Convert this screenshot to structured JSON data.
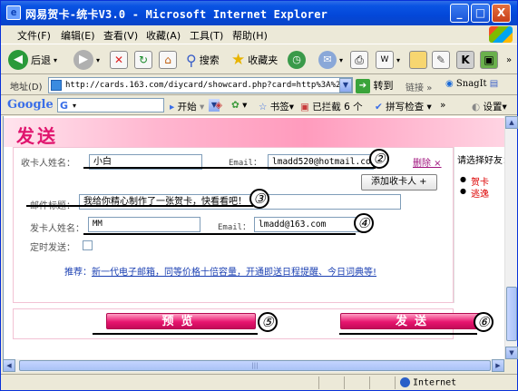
{
  "window": {
    "title": "网易贺卡-统卡V3.0 - Microsoft Internet Explorer",
    "controls": {
      "minimize": "_",
      "maximize": "□",
      "close": "X"
    }
  },
  "menu": [
    "文件(F)",
    "编辑(E)",
    "查看(V)",
    "收藏(A)",
    "工具(T)",
    "帮助(H)"
  ],
  "toolbar": {
    "back": "后退",
    "search": "搜索",
    "favorites": "收藏夹",
    "more": "»"
  },
  "address": {
    "label": "地址(D)",
    "url": "http://cards.163.com/diycard/showcard.php?card=http%3A%2F%2Fc",
    "go": "转到",
    "links": "链接",
    "more": "»",
    "snagit": "SnagIt"
  },
  "google_bar": {
    "logo": "Google",
    "start": "开始",
    "bookmarks": "书签",
    "blocked": "已拦截 6 个",
    "spellcheck": "拼写检查",
    "more": "»",
    "settings": "设置"
  },
  "page": {
    "heading": "发送",
    "recipient_label": "收卡人姓名：",
    "recipient_name": "小白",
    "email_label": "Email：",
    "recipient_email": "lmadd520@hotmail.com",
    "delete": "删除 ×",
    "add_recipient": "添加收卡人 +",
    "subject_label": "邮件标题：",
    "subject": "我给你精心制作了一张贺卡，快看看吧！",
    "sender_label": "发卡人姓名：",
    "sender_name": "MM",
    "sender_email_label": "Email：",
    "sender_email": "lmadd@163.com",
    "schedule_label": "定时发送：",
    "promo_prefix": "推荐：",
    "promo_link": "新一代电子邮箱，同等价格十倍容量，开通即送日程提醒、今日词典等!",
    "friends_title": "请选择好友：",
    "friends": [
      "贺卡",
      "逃逸"
    ],
    "preview_button": "预览",
    "send_button": "发送"
  },
  "annotations": [
    "②",
    "③",
    "④",
    "⑤",
    "⑥"
  ],
  "status": {
    "zone": "Internet"
  }
}
